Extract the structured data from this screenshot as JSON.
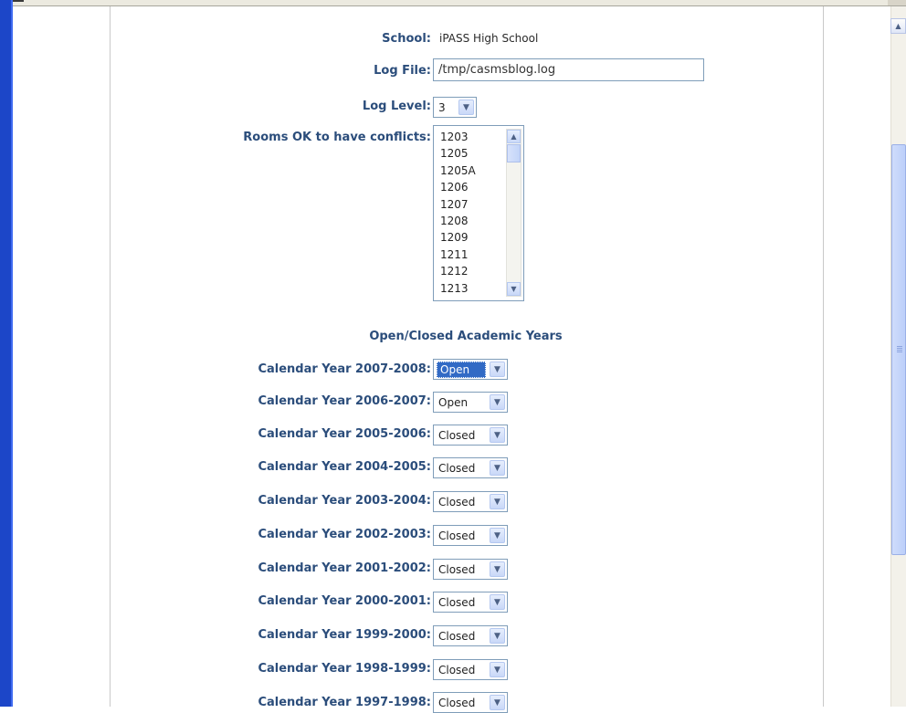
{
  "form": {
    "school_label": "School:",
    "school_value": "iPASS High School",
    "logfile_label": "Log File:",
    "logfile_value": "/tmp/casmsblog.log",
    "loglevel_label": "Log Level:",
    "loglevel_value": "3",
    "rooms_label": "Rooms OK to have conflicts:",
    "rooms": [
      "1203",
      "1205",
      "1205A",
      "1206",
      "1207",
      "1208",
      "1209",
      "1211",
      "1212",
      "1213"
    ]
  },
  "years": {
    "title": "Open/Closed Academic Years",
    "rows": [
      {
        "label": "Calendar Year 2007-2008:",
        "value": "Open"
      },
      {
        "label": "Calendar Year 2006-2007:",
        "value": "Open"
      },
      {
        "label": "Calendar Year 2005-2006:",
        "value": "Closed"
      },
      {
        "label": "Calendar Year 2004-2005:",
        "value": "Closed"
      },
      {
        "label": "Calendar Year 2003-2004:",
        "value": "Closed"
      },
      {
        "label": "Calendar Year 2002-2003:",
        "value": "Closed"
      },
      {
        "label": "Calendar Year 2001-2002:",
        "value": "Closed"
      },
      {
        "label": "Calendar Year 2000-2001:",
        "value": "Closed"
      },
      {
        "label": "Calendar Year 1999-2000:",
        "value": "Closed"
      },
      {
        "label": "Calendar Year 1998-1999:",
        "value": "Closed"
      },
      {
        "label": "Calendar Year 1997-1998:",
        "value": "Closed"
      }
    ]
  },
  "icons": {
    "dropdown": "chevron-down-icon",
    "scroll_up": "arrow-up-icon",
    "scroll_down": "arrow-down-icon"
  }
}
